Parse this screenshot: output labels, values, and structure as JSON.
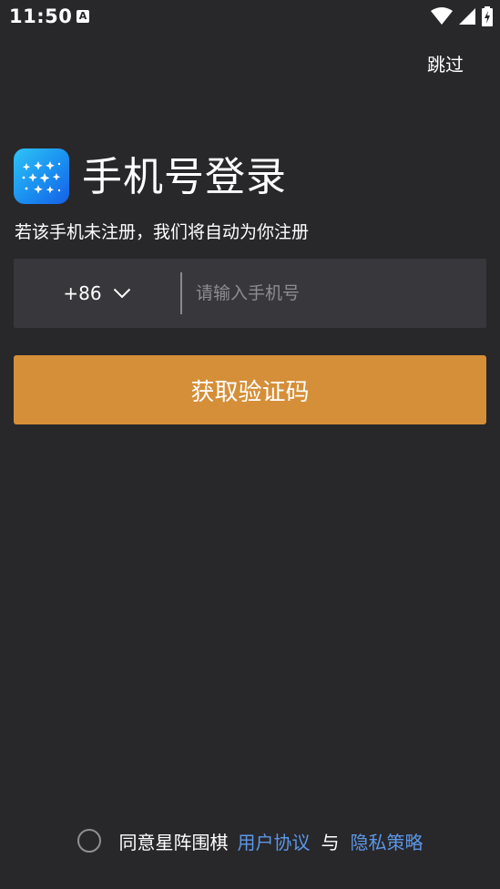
{
  "status_bar": {
    "time": "11:50",
    "notification_icon_letter": "A",
    "icons": [
      "wifi-icon",
      "signal-icon",
      "battery-charging-icon"
    ]
  },
  "header": {
    "skip_label": "跳过"
  },
  "login": {
    "title": "手机号登录",
    "subtitle": "若该手机未注册，我们将自动为你注册",
    "country_code": "+86",
    "phone_placeholder": "请输入手机号",
    "phone_value": "",
    "get_code_label": "获取验证码"
  },
  "agreement": {
    "prefix": "同意星阵围棋",
    "user_agreement": "用户协议",
    "and": "与",
    "privacy_policy": "隐私策略",
    "checked": false
  },
  "colors": {
    "background": "#28272a",
    "input_background": "#38373b",
    "primary_button": "#d58f38",
    "link": "#5c97e6"
  }
}
